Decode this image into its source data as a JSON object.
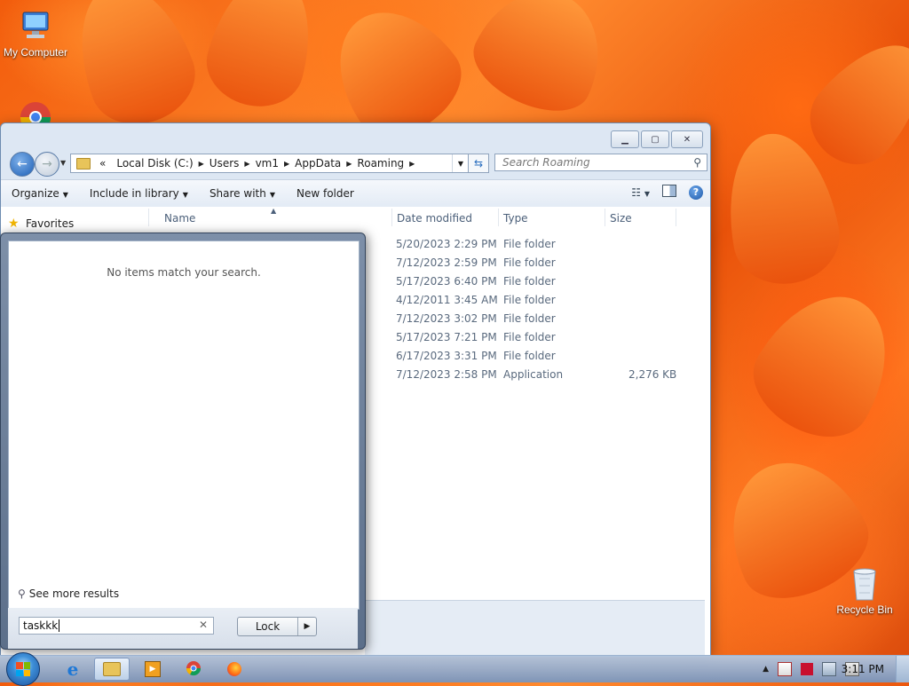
{
  "desktop": {
    "my_computer_label": "My Computer",
    "recycle_bin_label": "Recycle Bin"
  },
  "explorer": {
    "address": {
      "overflow": "«",
      "crumbs": [
        "Local Disk (C:)",
        "Users",
        "vm1",
        "AppData",
        "Roaming"
      ]
    },
    "search_placeholder": "Search Roaming",
    "toolbar": {
      "organize": "Organize",
      "include_in_library": "Include in library",
      "share_with": "Share with",
      "new_folder": "New folder"
    },
    "columns": {
      "name": "Name",
      "date_modified": "Date modified",
      "type": "Type",
      "size": "Size"
    },
    "nav": {
      "favorites": "Favorites"
    },
    "rows": [
      {
        "date": "5/20/2023 2:29 PM",
        "type": "File folder",
        "size": ""
      },
      {
        "date": "7/12/2023 2:59 PM",
        "type": "File folder",
        "size": ""
      },
      {
        "date": "5/17/2023 6:40 PM",
        "type": "File folder",
        "size": ""
      },
      {
        "date": "4/12/2011 3:45 AM",
        "type": "File folder",
        "size": ""
      },
      {
        "date": "7/12/2023 3:02 PM",
        "type": "File folder",
        "size": ""
      },
      {
        "date": "5/17/2023 7:21 PM",
        "type": "File folder",
        "size": ""
      },
      {
        "date": "6/17/2023 3:31 PM",
        "type": "File folder",
        "size": ""
      },
      {
        "date": "7/12/2023 2:58 PM",
        "type": "Application",
        "size": "2,276 KB"
      }
    ]
  },
  "start_menu": {
    "no_items": "No items match your search.",
    "see_more": "See more results",
    "search_value": "taskkk",
    "lock_label": "Lock"
  },
  "taskbar": {
    "clock": "3:11 PM"
  }
}
